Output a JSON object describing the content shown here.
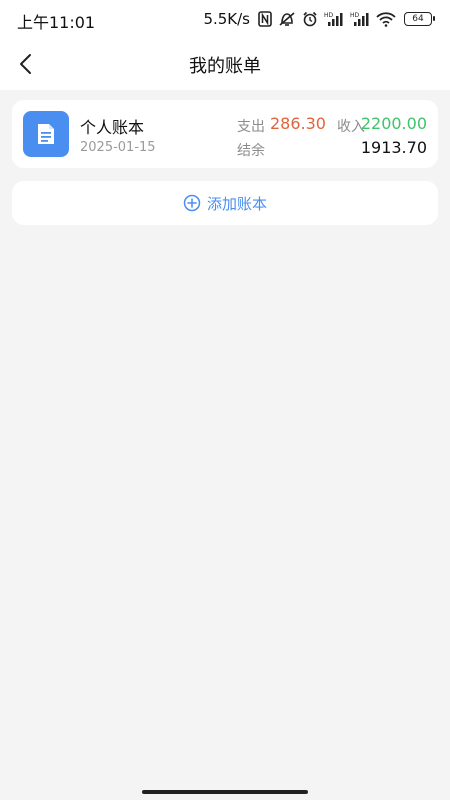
{
  "status_bar": {
    "time": "上午11:01",
    "network_speed": "5.5K/s",
    "battery_level": "64",
    "icons": [
      "nfc-icon",
      "mute-icon",
      "alarm-icon",
      "hd-signal-icon",
      "hd-signal-icon",
      "wifi-icon",
      "battery-icon"
    ]
  },
  "nav": {
    "title": "我的账单",
    "back_icon": "chevron-left-icon"
  },
  "ledger": {
    "name": "个人账本",
    "date": "2025-01-15",
    "expense_label": "支出",
    "expense_value": "286.30",
    "income_label": "收入",
    "income_value": "2200.00",
    "balance_label": "结余",
    "balance_value": "1913.70",
    "icon": "document-icon"
  },
  "add_ledger": {
    "label": "添加账本",
    "icon": "plus-circle-icon"
  },
  "colors": {
    "accent": "#4a8ff0",
    "expense": "#e0643c",
    "income": "#3fc46a",
    "background": "#f4f4f4"
  }
}
